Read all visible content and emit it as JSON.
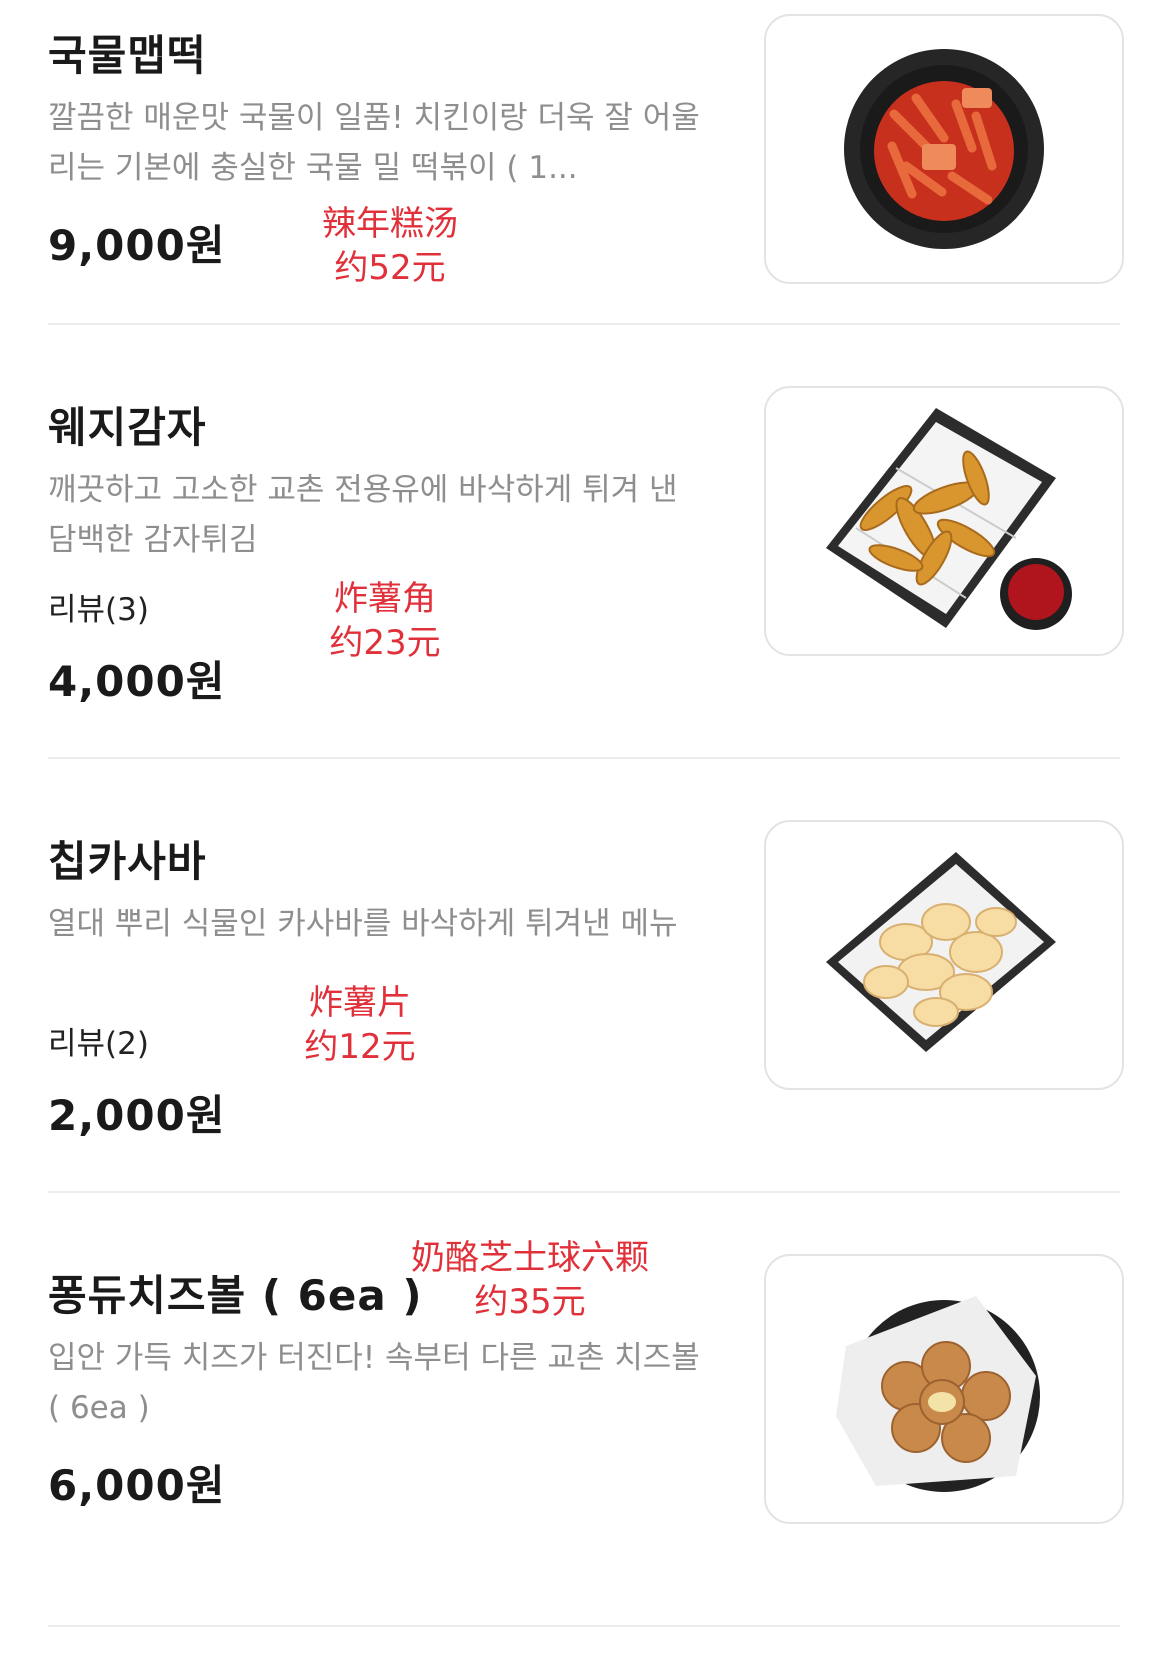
{
  "menu": [
    {
      "name": "국물맵떡",
      "desc": "깔끔한 매운맛 국물이 일품! 치킨이랑 더욱 잘 어울리는 기본에 충실한 국물 밀 떡볶이 ( 1...",
      "review": "",
      "price": "9,000원",
      "note_line1": "辣年糕汤",
      "note_line2": "约52元",
      "image_icon": "tteokbokki-bowl-icon"
    },
    {
      "name": "웨지감자",
      "desc": "깨끗하고 고소한 교촌 전용유에 바삭하게 튀겨 낸 담백한 감자튀김",
      "review": "리뷰(3)",
      "price": "4,000원",
      "note_line1": "炸薯角",
      "note_line2": "约23元",
      "image_icon": "potato-wedges-basket-icon"
    },
    {
      "name": "칩카사바",
      "desc": "열대 뿌리 식물인 카사바를 바삭하게 튀겨낸 메뉴",
      "review": "리뷰(2)",
      "price": "2,000원",
      "note_line1": "炸薯片",
      "note_line2": "约12元",
      "image_icon": "cassava-chips-basket-icon"
    },
    {
      "name": "퐁듀치즈볼 ( 6ea )",
      "desc": "입안 가득 치즈가 터진다! 속부터 다른 교촌 치즈볼 ( 6ea )",
      "review": "",
      "price": "6,000원",
      "note_line1": "奶酪芝士球六颗",
      "note_line2": "约35元",
      "image_icon": "cheese-balls-plate-icon"
    }
  ],
  "colors": {
    "note_red": "#e0303a",
    "desc_gray": "#8e8e8e",
    "divider": "#ececec"
  }
}
